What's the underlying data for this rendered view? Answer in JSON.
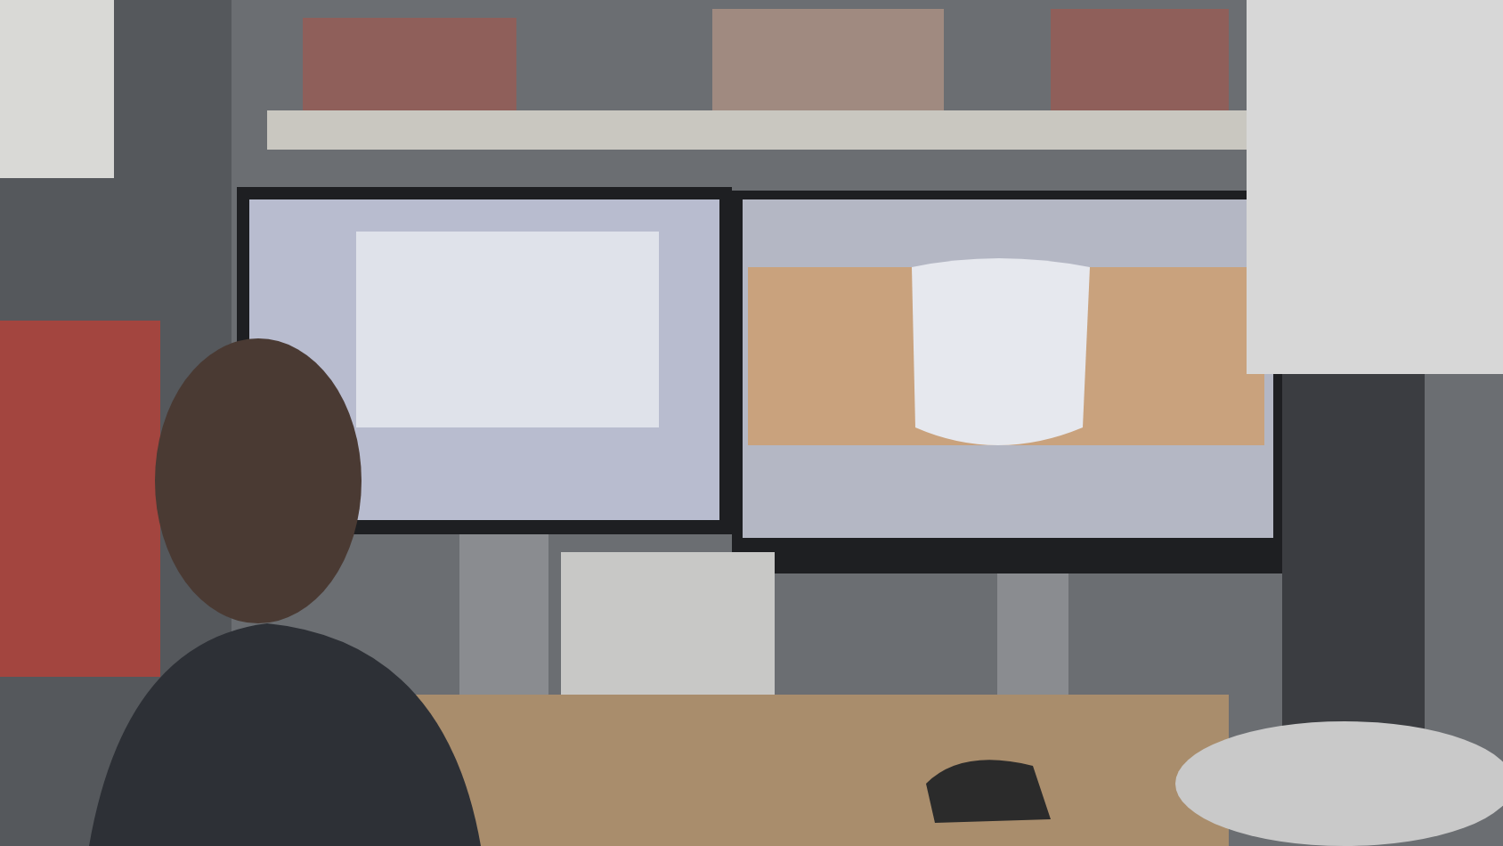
{
  "scene": {
    "kind": "photo"
  }
}
